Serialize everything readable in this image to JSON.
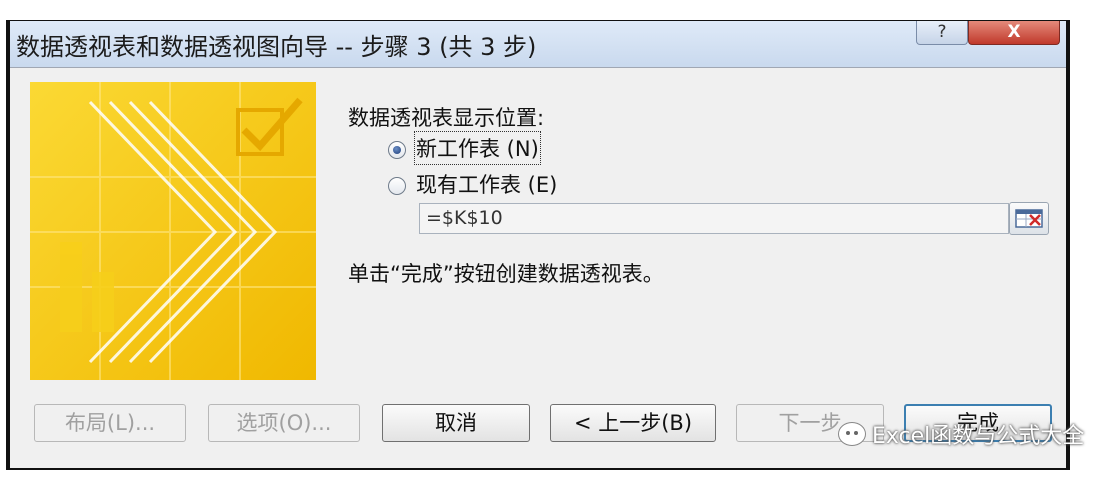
{
  "dialog": {
    "title": "数据透视表和数据透视图向导 -- 步骤 3 (共 3 步)",
    "help_label": "?",
    "close_label": "X"
  },
  "placement": {
    "prompt": "数据透视表显示位置:",
    "options": [
      {
        "label": "新工作表 (N)",
        "selected": true
      },
      {
        "label": "现有工作表 (E)",
        "selected": false
      }
    ],
    "location_value": "=$K$10"
  },
  "instruction": "单击“完成”按钮创建数据透视表。",
  "buttons": {
    "layout": "布局(L)...",
    "options": "选项(O)...",
    "cancel": "取消",
    "back": "< 上一步(B)",
    "next": "下一步",
    "finish": "完成"
  },
  "watermark": "Excel函数与公式大全",
  "colors": {
    "art_yellow": "#f6c900",
    "close_red": "#c0392b",
    "title_bg": "#d3e1f3"
  }
}
